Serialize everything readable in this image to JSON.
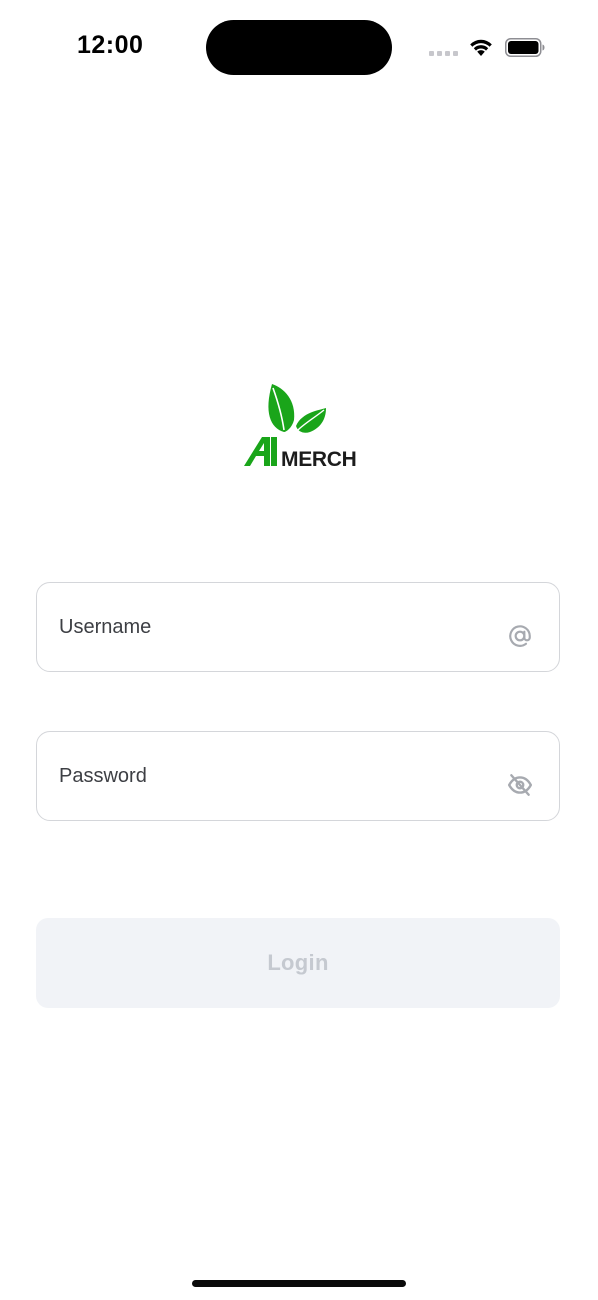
{
  "status_bar": {
    "time": "12:00",
    "signal_icon": "cellular-signal-icon",
    "wifi_icon": "wifi-icon",
    "battery_icon": "battery-icon"
  },
  "logo": {
    "icon": "leaf-logo-icon",
    "brand_ai": "AI",
    "brand_merch": "MERCH",
    "brand_color": "#1aa51a"
  },
  "form": {
    "username": {
      "value": "",
      "placeholder": "Username",
      "icon": "at-sign-icon"
    },
    "password": {
      "value": "",
      "placeholder": "Password",
      "icon": "eye-off-icon"
    },
    "login_label": "Login"
  },
  "colors": {
    "field_border": "#d4d6da",
    "button_bg_disabled": "#f1f3f7",
    "button_text_disabled": "#c5c9d0",
    "icon_gray": "#a7aab0"
  }
}
